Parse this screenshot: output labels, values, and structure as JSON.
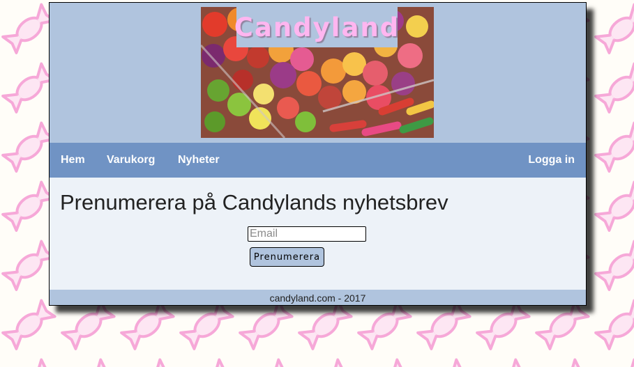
{
  "site": {
    "brand": "Candyland"
  },
  "nav": {
    "home": "Hem",
    "cart": "Varukorg",
    "news": "Nyheter",
    "login": "Logga in"
  },
  "main": {
    "heading": "Prenumerera på Candylands nyhetsbrev",
    "email_placeholder": "Email",
    "email_value": "",
    "subscribe_label": "Prenumerera"
  },
  "footer": {
    "text": "candyland.com - 2017"
  },
  "colors": {
    "header_bg": "#b0c4de",
    "nav_bg": "#7093c4",
    "content_bg": "#edf2f8",
    "brand_text": "#ffb6f0",
    "candy_wrapper": "#f6a8d8"
  }
}
